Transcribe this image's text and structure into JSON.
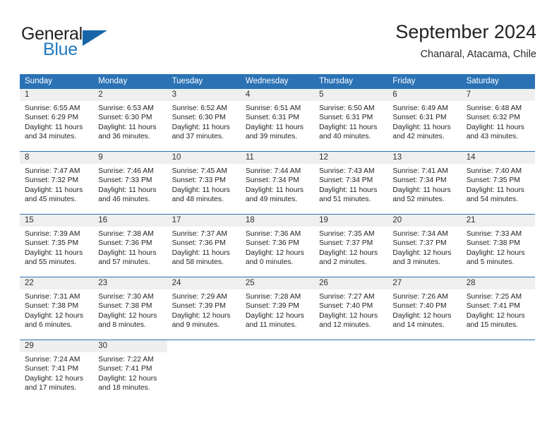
{
  "brand": {
    "name_top": "General",
    "name_bottom": "Blue",
    "accent_color": "#1f7ac1",
    "triangle_color": "#1565a8"
  },
  "header": {
    "title": "September 2024",
    "subtitle": "Chanaral, Atacama, Chile"
  },
  "calendar": {
    "header_bg": "#2b72b5",
    "daynum_bg": "#efefef",
    "weekdays": [
      "Sunday",
      "Monday",
      "Tuesday",
      "Wednesday",
      "Thursday",
      "Friday",
      "Saturday"
    ],
    "weeks": [
      [
        {
          "day": "1",
          "lines": [
            "Sunrise: 6:55 AM",
            "Sunset: 6:29 PM",
            "Daylight: 11 hours",
            "and 34 minutes."
          ]
        },
        {
          "day": "2",
          "lines": [
            "Sunrise: 6:53 AM",
            "Sunset: 6:30 PM",
            "Daylight: 11 hours",
            "and 36 minutes."
          ]
        },
        {
          "day": "3",
          "lines": [
            "Sunrise: 6:52 AM",
            "Sunset: 6:30 PM",
            "Daylight: 11 hours",
            "and 37 minutes."
          ]
        },
        {
          "day": "4",
          "lines": [
            "Sunrise: 6:51 AM",
            "Sunset: 6:31 PM",
            "Daylight: 11 hours",
            "and 39 minutes."
          ]
        },
        {
          "day": "5",
          "lines": [
            "Sunrise: 6:50 AM",
            "Sunset: 6:31 PM",
            "Daylight: 11 hours",
            "and 40 minutes."
          ]
        },
        {
          "day": "6",
          "lines": [
            "Sunrise: 6:49 AM",
            "Sunset: 6:31 PM",
            "Daylight: 11 hours",
            "and 42 minutes."
          ]
        },
        {
          "day": "7",
          "lines": [
            "Sunrise: 6:48 AM",
            "Sunset: 6:32 PM",
            "Daylight: 11 hours",
            "and 43 minutes."
          ]
        }
      ],
      [
        {
          "day": "8",
          "lines": [
            "Sunrise: 7:47 AM",
            "Sunset: 7:32 PM",
            "Daylight: 11 hours",
            "and 45 minutes."
          ]
        },
        {
          "day": "9",
          "lines": [
            "Sunrise: 7:46 AM",
            "Sunset: 7:33 PM",
            "Daylight: 11 hours",
            "and 46 minutes."
          ]
        },
        {
          "day": "10",
          "lines": [
            "Sunrise: 7:45 AM",
            "Sunset: 7:33 PM",
            "Daylight: 11 hours",
            "and 48 minutes."
          ]
        },
        {
          "day": "11",
          "lines": [
            "Sunrise: 7:44 AM",
            "Sunset: 7:34 PM",
            "Daylight: 11 hours",
            "and 49 minutes."
          ]
        },
        {
          "day": "12",
          "lines": [
            "Sunrise: 7:43 AM",
            "Sunset: 7:34 PM",
            "Daylight: 11 hours",
            "and 51 minutes."
          ]
        },
        {
          "day": "13",
          "lines": [
            "Sunrise: 7:41 AM",
            "Sunset: 7:34 PM",
            "Daylight: 11 hours",
            "and 52 minutes."
          ]
        },
        {
          "day": "14",
          "lines": [
            "Sunrise: 7:40 AM",
            "Sunset: 7:35 PM",
            "Daylight: 11 hours",
            "and 54 minutes."
          ]
        }
      ],
      [
        {
          "day": "15",
          "lines": [
            "Sunrise: 7:39 AM",
            "Sunset: 7:35 PM",
            "Daylight: 11 hours",
            "and 55 minutes."
          ]
        },
        {
          "day": "16",
          "lines": [
            "Sunrise: 7:38 AM",
            "Sunset: 7:36 PM",
            "Daylight: 11 hours",
            "and 57 minutes."
          ]
        },
        {
          "day": "17",
          "lines": [
            "Sunrise: 7:37 AM",
            "Sunset: 7:36 PM",
            "Daylight: 11 hours",
            "and 58 minutes."
          ]
        },
        {
          "day": "18",
          "lines": [
            "Sunrise: 7:36 AM",
            "Sunset: 7:36 PM",
            "Daylight: 12 hours",
            "and 0 minutes."
          ]
        },
        {
          "day": "19",
          "lines": [
            "Sunrise: 7:35 AM",
            "Sunset: 7:37 PM",
            "Daylight: 12 hours",
            "and 2 minutes."
          ]
        },
        {
          "day": "20",
          "lines": [
            "Sunrise: 7:34 AM",
            "Sunset: 7:37 PM",
            "Daylight: 12 hours",
            "and 3 minutes."
          ]
        },
        {
          "day": "21",
          "lines": [
            "Sunrise: 7:33 AM",
            "Sunset: 7:38 PM",
            "Daylight: 12 hours",
            "and 5 minutes."
          ]
        }
      ],
      [
        {
          "day": "22",
          "lines": [
            "Sunrise: 7:31 AM",
            "Sunset: 7:38 PM",
            "Daylight: 12 hours",
            "and 6 minutes."
          ]
        },
        {
          "day": "23",
          "lines": [
            "Sunrise: 7:30 AM",
            "Sunset: 7:38 PM",
            "Daylight: 12 hours",
            "and 8 minutes."
          ]
        },
        {
          "day": "24",
          "lines": [
            "Sunrise: 7:29 AM",
            "Sunset: 7:39 PM",
            "Daylight: 12 hours",
            "and 9 minutes."
          ]
        },
        {
          "day": "25",
          "lines": [
            "Sunrise: 7:28 AM",
            "Sunset: 7:39 PM",
            "Daylight: 12 hours",
            "and 11 minutes."
          ]
        },
        {
          "day": "26",
          "lines": [
            "Sunrise: 7:27 AM",
            "Sunset: 7:40 PM",
            "Daylight: 12 hours",
            "and 12 minutes."
          ]
        },
        {
          "day": "27",
          "lines": [
            "Sunrise: 7:26 AM",
            "Sunset: 7:40 PM",
            "Daylight: 12 hours",
            "and 14 minutes."
          ]
        },
        {
          "day": "28",
          "lines": [
            "Sunrise: 7:25 AM",
            "Sunset: 7:41 PM",
            "Daylight: 12 hours",
            "and 15 minutes."
          ]
        }
      ],
      [
        {
          "day": "29",
          "lines": [
            "Sunrise: 7:24 AM",
            "Sunset: 7:41 PM",
            "Daylight: 12 hours",
            "and 17 minutes."
          ]
        },
        {
          "day": "30",
          "lines": [
            "Sunrise: 7:22 AM",
            "Sunset: 7:41 PM",
            "Daylight: 12 hours",
            "and 18 minutes."
          ]
        },
        {
          "day": "",
          "lines": []
        },
        {
          "day": "",
          "lines": []
        },
        {
          "day": "",
          "lines": []
        },
        {
          "day": "",
          "lines": []
        },
        {
          "day": "",
          "lines": []
        }
      ]
    ]
  }
}
